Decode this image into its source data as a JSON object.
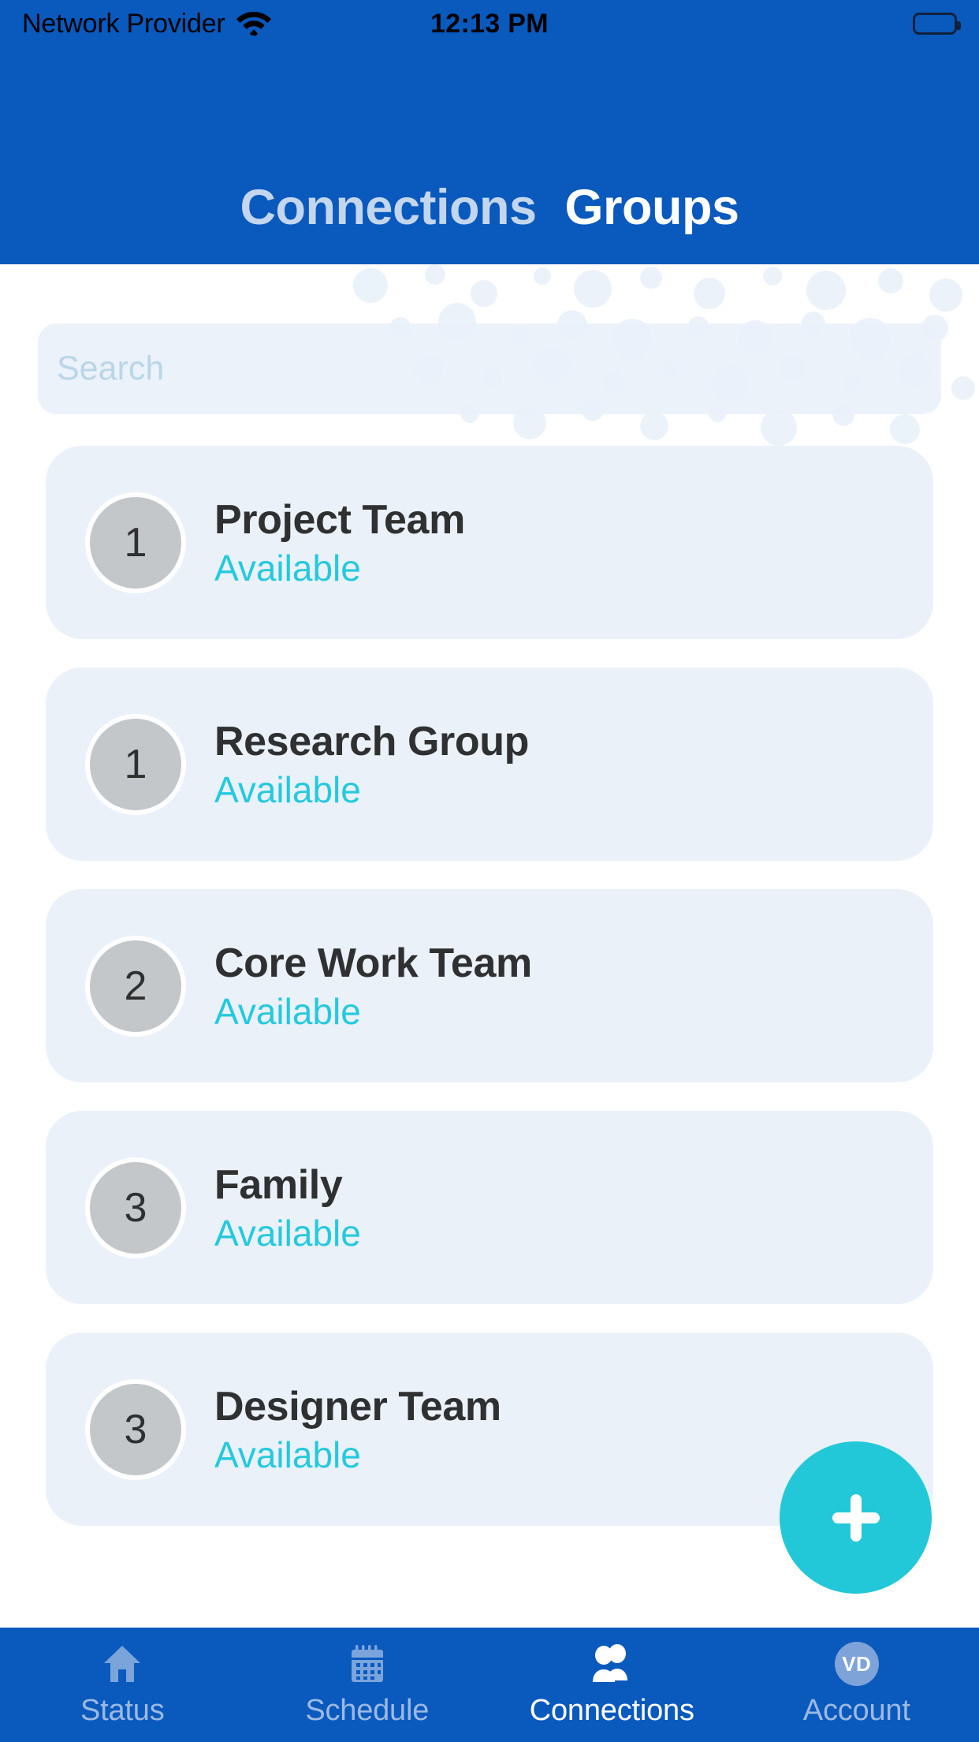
{
  "status_bar": {
    "carrier": "Network Provider",
    "time": "12:13 PM",
    "wifi_icon": "wifi-icon",
    "battery_icon": "battery-full-icon"
  },
  "header": {
    "tabs": [
      {
        "label": "Connections",
        "active": false
      },
      {
        "label": "Groups",
        "active": true
      }
    ]
  },
  "search": {
    "placeholder": "Search",
    "value": ""
  },
  "groups": {
    "items": [
      {
        "initial": "1",
        "title": "Project Team",
        "status": "Available"
      },
      {
        "initial": "1",
        "title": "Research Group",
        "status": "Available"
      },
      {
        "initial": "2",
        "title": "Core Work Team",
        "status": "Available"
      },
      {
        "initial": "3",
        "title": "Family",
        "status": "Available"
      },
      {
        "initial": "3",
        "title": "Designer Team",
        "status": "Available"
      }
    ]
  },
  "fab": {
    "icon": "plus-icon",
    "label": "Add group"
  },
  "bottom_nav": {
    "items": [
      {
        "label": "Status",
        "icon": "home-icon",
        "active": false
      },
      {
        "label": "Schedule",
        "icon": "calendar-icon",
        "active": false
      },
      {
        "label": "Connections",
        "icon": "people-icon",
        "active": true
      },
      {
        "label": "Account",
        "icon": "avatar-icon",
        "active": false,
        "initials": "VD"
      }
    ]
  },
  "colors": {
    "header_blue": "#0a59bd",
    "card_bg": "#eaf1f9",
    "status_cyan": "#25c9de",
    "fab_cyan": "#22c8d8",
    "tab_inactive": "#c3d6ee"
  }
}
